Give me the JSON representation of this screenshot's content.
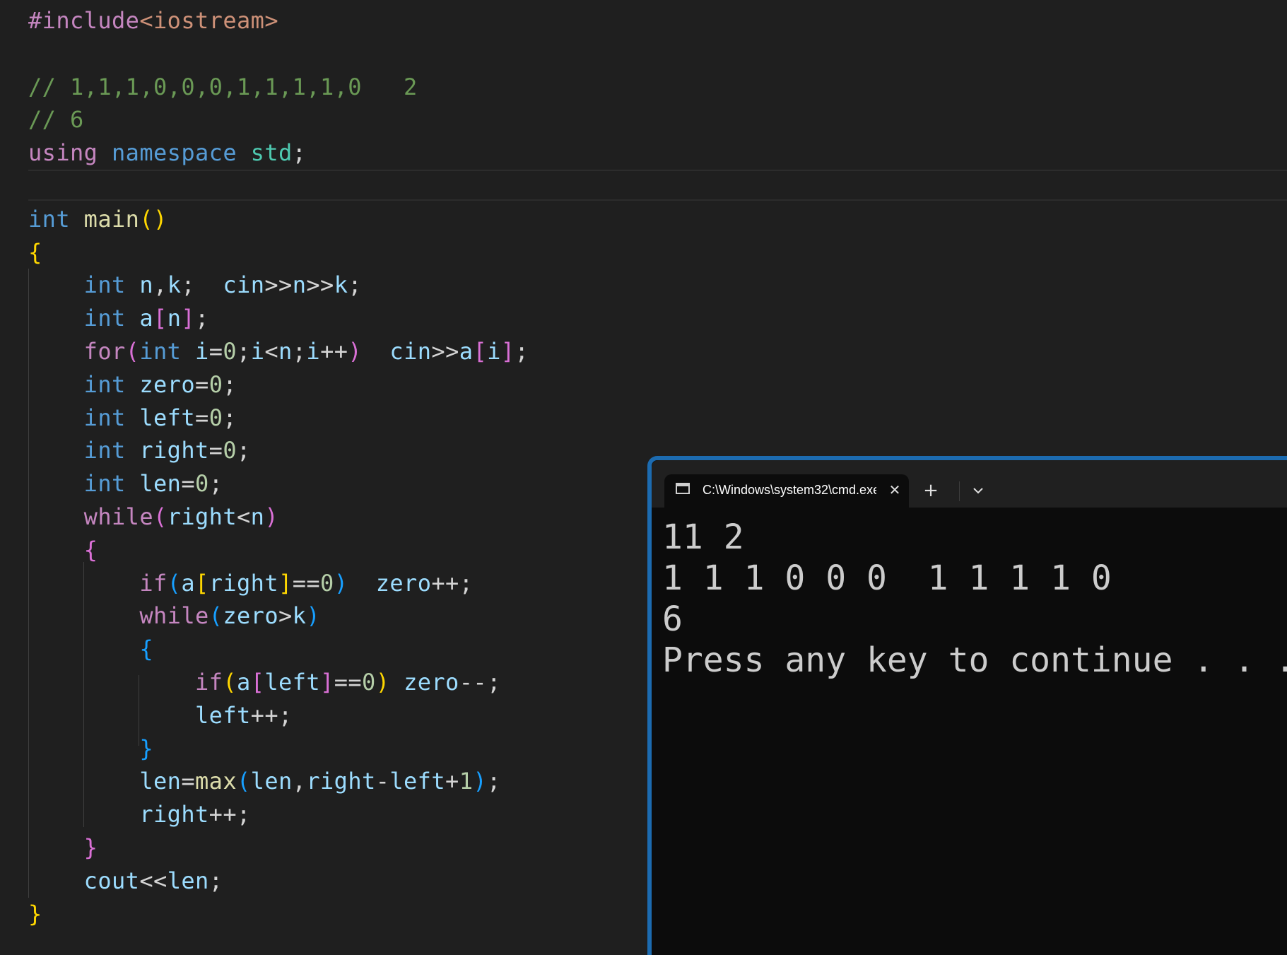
{
  "editor": {
    "lines": [
      [
        [
          "#include",
          "#c586c0"
        ],
        [
          "<iostream>",
          "#ce9178"
        ]
      ],
      [],
      [
        [
          "// 1,1,1,0,0,0,1,1,1,1,0   2",
          "#6a9955"
        ]
      ],
      [
        [
          "// 6",
          "#6a9955"
        ]
      ],
      [
        [
          "using",
          "#c586c0"
        ],
        [
          " ",
          "#d4d4d4"
        ],
        [
          "namespace",
          "#569cd6"
        ],
        [
          " ",
          "#d4d4d4"
        ],
        [
          "std",
          "#4ec9b0"
        ],
        [
          ";",
          "#d4d4d4"
        ]
      ],
      [],
      [
        [
          "int",
          "#569cd6"
        ],
        [
          " ",
          "#d4d4d4"
        ],
        [
          "main",
          "#dcdcaa"
        ],
        [
          "()",
          "#ffd700"
        ]
      ],
      [
        [
          "{",
          "#ffd700"
        ]
      ],
      [
        [
          "    ",
          "#d4d4d4"
        ],
        [
          "int",
          "#569cd6"
        ],
        [
          " ",
          "#d4d4d4"
        ],
        [
          "n",
          "#9cdcfe"
        ],
        [
          ",",
          "#d4d4d4"
        ],
        [
          "k",
          "#9cdcfe"
        ],
        [
          ";  ",
          "#d4d4d4"
        ],
        [
          "cin",
          "#9cdcfe"
        ],
        [
          ">>",
          "#d4d4d4"
        ],
        [
          "n",
          "#9cdcfe"
        ],
        [
          ">>",
          "#d4d4d4"
        ],
        [
          "k",
          "#9cdcfe"
        ],
        [
          ";",
          "#d4d4d4"
        ]
      ],
      [
        [
          "    ",
          "#d4d4d4"
        ],
        [
          "int",
          "#569cd6"
        ],
        [
          " ",
          "#d4d4d4"
        ],
        [
          "a",
          "#9cdcfe"
        ],
        [
          "[",
          "#da70d6"
        ],
        [
          "n",
          "#9cdcfe"
        ],
        [
          "]",
          "#da70d6"
        ],
        [
          ";",
          "#d4d4d4"
        ]
      ],
      [
        [
          "    ",
          "#d4d4d4"
        ],
        [
          "for",
          "#c586c0"
        ],
        [
          "(",
          "#da70d6"
        ],
        [
          "int",
          "#569cd6"
        ],
        [
          " ",
          "#d4d4d4"
        ],
        [
          "i",
          "#9cdcfe"
        ],
        [
          "=",
          "#d4d4d4"
        ],
        [
          "0",
          "#b5cea8"
        ],
        [
          ";",
          "#d4d4d4"
        ],
        [
          "i",
          "#9cdcfe"
        ],
        [
          "<",
          "#d4d4d4"
        ],
        [
          "n",
          "#9cdcfe"
        ],
        [
          ";",
          "#d4d4d4"
        ],
        [
          "i",
          "#9cdcfe"
        ],
        [
          "++",
          "#d4d4d4"
        ],
        [
          ")",
          "#da70d6"
        ],
        [
          "  ",
          "#d4d4d4"
        ],
        [
          "cin",
          "#9cdcfe"
        ],
        [
          ">>",
          "#d4d4d4"
        ],
        [
          "a",
          "#9cdcfe"
        ],
        [
          "[",
          "#da70d6"
        ],
        [
          "i",
          "#9cdcfe"
        ],
        [
          "]",
          "#da70d6"
        ],
        [
          ";",
          "#d4d4d4"
        ]
      ],
      [
        [
          "    ",
          "#d4d4d4"
        ],
        [
          "int",
          "#569cd6"
        ],
        [
          " ",
          "#d4d4d4"
        ],
        [
          "zero",
          "#9cdcfe"
        ],
        [
          "=",
          "#d4d4d4"
        ],
        [
          "0",
          "#b5cea8"
        ],
        [
          ";",
          "#d4d4d4"
        ]
      ],
      [
        [
          "    ",
          "#d4d4d4"
        ],
        [
          "int",
          "#569cd6"
        ],
        [
          " ",
          "#d4d4d4"
        ],
        [
          "left",
          "#9cdcfe"
        ],
        [
          "=",
          "#d4d4d4"
        ],
        [
          "0",
          "#b5cea8"
        ],
        [
          ";",
          "#d4d4d4"
        ]
      ],
      [
        [
          "    ",
          "#d4d4d4"
        ],
        [
          "int",
          "#569cd6"
        ],
        [
          " ",
          "#d4d4d4"
        ],
        [
          "right",
          "#9cdcfe"
        ],
        [
          "=",
          "#d4d4d4"
        ],
        [
          "0",
          "#b5cea8"
        ],
        [
          ";",
          "#d4d4d4"
        ]
      ],
      [
        [
          "    ",
          "#d4d4d4"
        ],
        [
          "int",
          "#569cd6"
        ],
        [
          " ",
          "#d4d4d4"
        ],
        [
          "len",
          "#9cdcfe"
        ],
        [
          "=",
          "#d4d4d4"
        ],
        [
          "0",
          "#b5cea8"
        ],
        [
          ";",
          "#d4d4d4"
        ]
      ],
      [
        [
          "    ",
          "#d4d4d4"
        ],
        [
          "while",
          "#c586c0"
        ],
        [
          "(",
          "#da70d6"
        ],
        [
          "right",
          "#9cdcfe"
        ],
        [
          "<",
          "#d4d4d4"
        ],
        [
          "n",
          "#9cdcfe"
        ],
        [
          ")",
          "#da70d6"
        ]
      ],
      [
        [
          "    ",
          "#d4d4d4"
        ],
        [
          "{",
          "#da70d6"
        ]
      ],
      [
        [
          "        ",
          "#d4d4d4"
        ],
        [
          "if",
          "#c586c0"
        ],
        [
          "(",
          "#179fff"
        ],
        [
          "a",
          "#9cdcfe"
        ],
        [
          "[",
          "#ffd700"
        ],
        [
          "right",
          "#9cdcfe"
        ],
        [
          "]",
          "#ffd700"
        ],
        [
          "==",
          "#d4d4d4"
        ],
        [
          "0",
          "#b5cea8"
        ],
        [
          ")",
          "#179fff"
        ],
        [
          "  ",
          "#d4d4d4"
        ],
        [
          "zero",
          "#9cdcfe"
        ],
        [
          "++",
          "#d4d4d4"
        ],
        [
          ";",
          "#d4d4d4"
        ]
      ],
      [
        [
          "        ",
          "#d4d4d4"
        ],
        [
          "while",
          "#c586c0"
        ],
        [
          "(",
          "#179fff"
        ],
        [
          "zero",
          "#9cdcfe"
        ],
        [
          ">",
          "#d4d4d4"
        ],
        [
          "k",
          "#9cdcfe"
        ],
        [
          ")",
          "#179fff"
        ]
      ],
      [
        [
          "        ",
          "#d4d4d4"
        ],
        [
          "{",
          "#179fff"
        ]
      ],
      [
        [
          "            ",
          "#d4d4d4"
        ],
        [
          "if",
          "#c586c0"
        ],
        [
          "(",
          "#ffd700"
        ],
        [
          "a",
          "#9cdcfe"
        ],
        [
          "[",
          "#da70d6"
        ],
        [
          "left",
          "#9cdcfe"
        ],
        [
          "]",
          "#da70d6"
        ],
        [
          "==",
          "#d4d4d4"
        ],
        [
          "0",
          "#b5cea8"
        ],
        [
          ")",
          "#ffd700"
        ],
        [
          " ",
          "#d4d4d4"
        ],
        [
          "zero",
          "#9cdcfe"
        ],
        [
          "--",
          "#d4d4d4"
        ],
        [
          ";",
          "#d4d4d4"
        ]
      ],
      [
        [
          "            ",
          "#d4d4d4"
        ],
        [
          "left",
          "#9cdcfe"
        ],
        [
          "++",
          "#d4d4d4"
        ],
        [
          ";",
          "#d4d4d4"
        ]
      ],
      [
        [
          "        ",
          "#d4d4d4"
        ],
        [
          "}",
          "#179fff"
        ]
      ],
      [
        [
          "        ",
          "#d4d4d4"
        ],
        [
          "len",
          "#9cdcfe"
        ],
        [
          "=",
          "#d4d4d4"
        ],
        [
          "max",
          "#dcdcaa"
        ],
        [
          "(",
          "#179fff"
        ],
        [
          "len",
          "#9cdcfe"
        ],
        [
          ",",
          "#d4d4d4"
        ],
        [
          "right",
          "#9cdcfe"
        ],
        [
          "-",
          "#d4d4d4"
        ],
        [
          "left",
          "#9cdcfe"
        ],
        [
          "+",
          "#d4d4d4"
        ],
        [
          "1",
          "#b5cea8"
        ],
        [
          ")",
          "#179fff"
        ],
        [
          ";",
          "#d4d4d4"
        ]
      ],
      [
        [
          "        ",
          "#d4d4d4"
        ],
        [
          "right",
          "#9cdcfe"
        ],
        [
          "++",
          "#d4d4d4"
        ],
        [
          ";",
          "#d4d4d4"
        ]
      ],
      [
        [
          "    ",
          "#d4d4d4"
        ],
        [
          "}",
          "#da70d6"
        ]
      ],
      [
        [
          "    ",
          "#d4d4d4"
        ],
        [
          "cout",
          "#9cdcfe"
        ],
        [
          "<<",
          "#d4d4d4"
        ],
        [
          "len",
          "#9cdcfe"
        ],
        [
          ";",
          "#d4d4d4"
        ]
      ],
      [
        [
          "}",
          "#ffd700"
        ]
      ]
    ]
  },
  "terminal": {
    "tab_title": "C:\\Windows\\system32\\cmd.exe",
    "close_glyph": "✕",
    "new_tab_glyph": "+",
    "icons": [
      "terminal-app-icon",
      "chevron-down-icon"
    ],
    "output": [
      "11 2",
      "1 1 1 0 0 0  1 1 1 1 0",
      "6",
      "Press any key to continue . . ."
    ]
  },
  "colors": {
    "editor_bg": "#1f1f1f",
    "terminal_bg": "#0c0c0c",
    "terminal_titlebar": "#202020",
    "terminal_border": "#1c6bb0",
    "terminal_text": "#cccccc"
  }
}
